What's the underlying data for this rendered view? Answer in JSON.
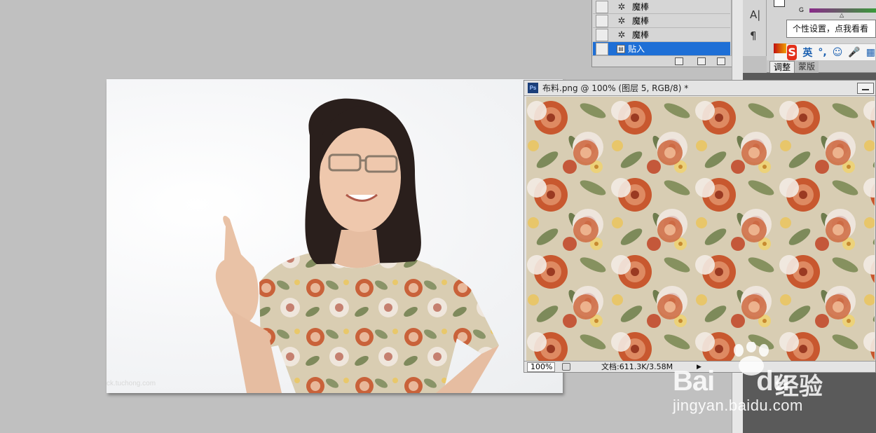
{
  "layers_panel": {
    "layers": [
      {
        "label": "魔棒",
        "icon": "magic-wand-icon",
        "active": false
      },
      {
        "label": "魔棒",
        "icon": "magic-wand-icon",
        "active": false
      },
      {
        "label": "魔棒",
        "icon": "magic-wand-icon",
        "active": false
      },
      {
        "label": "贴入",
        "icon": "paste-into-icon",
        "active": true
      }
    ]
  },
  "tool_dock": {
    "icons": [
      "character-panel-icon",
      "paragraph-panel-icon"
    ]
  },
  "color_panel": {
    "channel_label": "G"
  },
  "tooltip": {
    "text": "个性设置，点我看看"
  },
  "ime": {
    "logo": "S",
    "lang": "英",
    "punct": "°,"
  },
  "tabs": {
    "adjust": "调整",
    "mask": "蒙版"
  },
  "fabric_window": {
    "title": "布料.png @ 100% (图层 5, RGB/8) *",
    "zoom": "100%",
    "doc_info": "文档:611.3K/3.58M"
  },
  "main_document": {
    "image": "photo-woman-floral-shirt",
    "watermark": "ck.tuchong.com"
  },
  "baidu_watermark": {
    "brand": "Bai",
    "brand2": "du",
    "jingyan": "经验",
    "url": "jingyan.baidu.com"
  },
  "colors": {
    "selection": "#1e6fd6",
    "canvas_bg": "#c0c0c0",
    "panel_bg": "#d6d6d6"
  }
}
